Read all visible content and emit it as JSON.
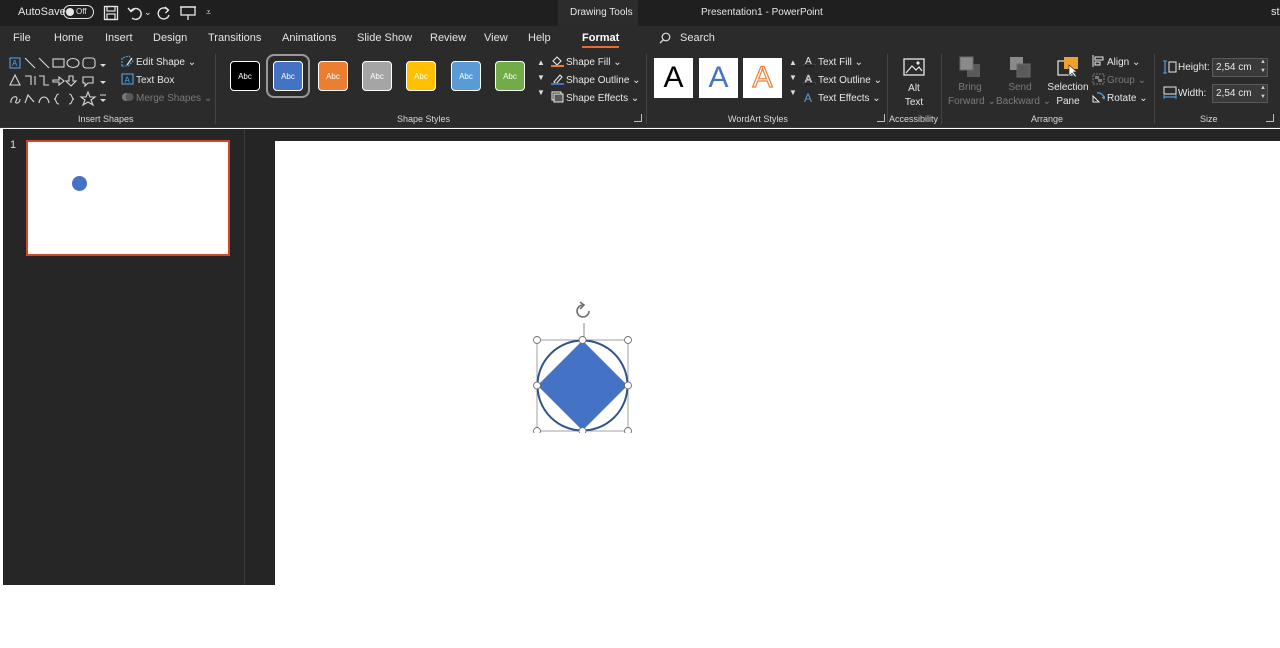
{
  "titlebar": {
    "autosave_label": "AutoSave",
    "autosave_state": "Off",
    "contextual_tab": "Drawing Tools",
    "document_title": "Presentation1  -  PowerPoint",
    "user_initials": "st"
  },
  "tabs": [
    "File",
    "Home",
    "Insert",
    "Design",
    "Transitions",
    "Animations",
    "Slide Show",
    "Review",
    "View",
    "Help",
    "Format"
  ],
  "active_tab": "Format",
  "search_label": "Search",
  "ribbon": {
    "insert_shapes": {
      "label": "Insert Shapes",
      "edit_shape": "Edit Shape",
      "text_box": "Text Box",
      "merge_shapes": "Merge Shapes"
    },
    "shape_styles": {
      "label": "Shape Styles",
      "swatch_text": "Abc",
      "swatches": [
        {
          "fill": "#000000",
          "text": "#ffffff",
          "border": "#ffffff"
        },
        {
          "fill": "#4472c4",
          "text": "#ffffff",
          "border": "#ffffff"
        },
        {
          "fill": "#ed7d31",
          "text": "#ffffff",
          "border": "#ffffff"
        },
        {
          "fill": "#a5a5a5",
          "text": "#ffffff",
          "border": "#ffffff"
        },
        {
          "fill": "#ffc000",
          "text": "#ffffff",
          "border": "#ffffff"
        },
        {
          "fill": "#5b9bd5",
          "text": "#ffffff",
          "border": "#ffffff"
        },
        {
          "fill": "#70ad47",
          "text": "#ffffff",
          "border": "#ffffff"
        }
      ],
      "shape_fill": "Shape Fill",
      "shape_outline": "Shape Outline",
      "shape_effects": "Shape Effects"
    },
    "wordart_styles": {
      "label": "WordArt Styles",
      "tile_letter": "A",
      "text_fill": "Text Fill",
      "text_outline": "Text Outline",
      "text_effects": "Text Effects"
    },
    "accessibility": {
      "label": "Accessibility",
      "alt_text_line1": "Alt",
      "alt_text_line2": "Text"
    },
    "arrange": {
      "label": "Arrange",
      "bring_forward_1": "Bring",
      "bring_forward_2": "Forward",
      "send_backward_1": "Send",
      "send_backward_2": "Backward",
      "selection_pane_1": "Selection",
      "selection_pane_2": "Pane",
      "align": "Align",
      "group": "Group",
      "rotate": "Rotate"
    },
    "size": {
      "label": "Size",
      "height_label": "Height:",
      "height_value": "2,54 cm",
      "width_label": "Width:",
      "width_value": "2,54 cm"
    }
  },
  "thumbnails": [
    {
      "number": "1"
    }
  ],
  "colors": {
    "accent": "#e86a35",
    "shape_fill": "#4472c4",
    "shape_outline": "#2f528f",
    "thumb_selection": "#d24726"
  }
}
